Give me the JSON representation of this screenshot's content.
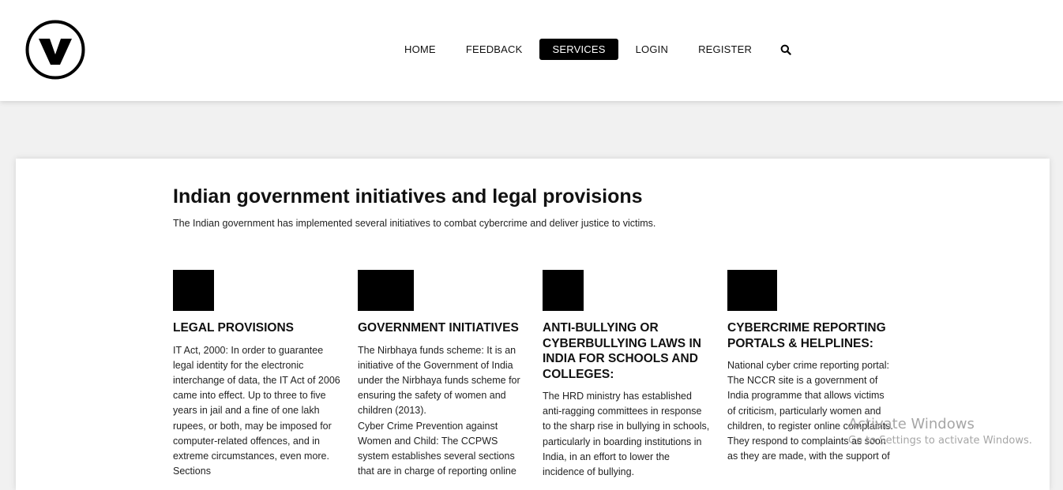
{
  "header": {
    "logo_letter": "V",
    "nav": [
      {
        "label": "HOME",
        "active": false
      },
      {
        "label": "FEEDBACK",
        "active": false
      },
      {
        "label": "SERVICES",
        "active": true
      },
      {
        "label": "LOGIN",
        "active": false
      },
      {
        "label": "REGISTER",
        "active": false
      }
    ],
    "search_icon": "search-icon"
  },
  "main": {
    "title": "Indian government initiatives and legal provisions",
    "subtitle": "The Indian government has implemented several initiatives to combat cybercrime and deliver justice to victims.",
    "columns": [
      {
        "heading": "LEGAL PROVISIONS",
        "text": "IT Act, 2000: In order to guarantee legal identity for the electronic interchange of data, the IT Act of 2006 came into effect. Up to three to five years in jail and a fine of one lakh rupees, or both, may be imposed for computer-related offences, and in extreme circumstances, even more. Sections"
      },
      {
        "heading": "GOVERNMENT INITIATIVES",
        "text": "The Nirbhaya funds scheme: It is an initiative of the Government of India under the Nirbhaya funds scheme for ensuring the safety of women and children (2013).\nCyber Crime Prevention against Women and Child: The CCPWS system establishes several sections that are in charge of reporting online"
      },
      {
        "heading": "ANTI-BULLYING OR CYBERBULLYING LAWS IN INDIA FOR SCHOOLS AND COLLEGES:",
        "text": "The HRD ministry has established anti-ragging committees in response to the sharp rise in bullying in schools, particularly in boarding institutions in India, in an effort to lower the incidence of bullying."
      },
      {
        "heading": "CYBERCRIME REPORTING PORTALS & HELPLINES:",
        "text": "National cyber crime reporting portal: The NCCR site is a government of India programme that allows victims of criticism, particularly women and children, to register online complaints. They respond to complaints as soon as they are made, with the support of"
      }
    ]
  },
  "watermark": {
    "title": "Activate Windows",
    "subtitle": "Go to Settings to activate Windows."
  }
}
